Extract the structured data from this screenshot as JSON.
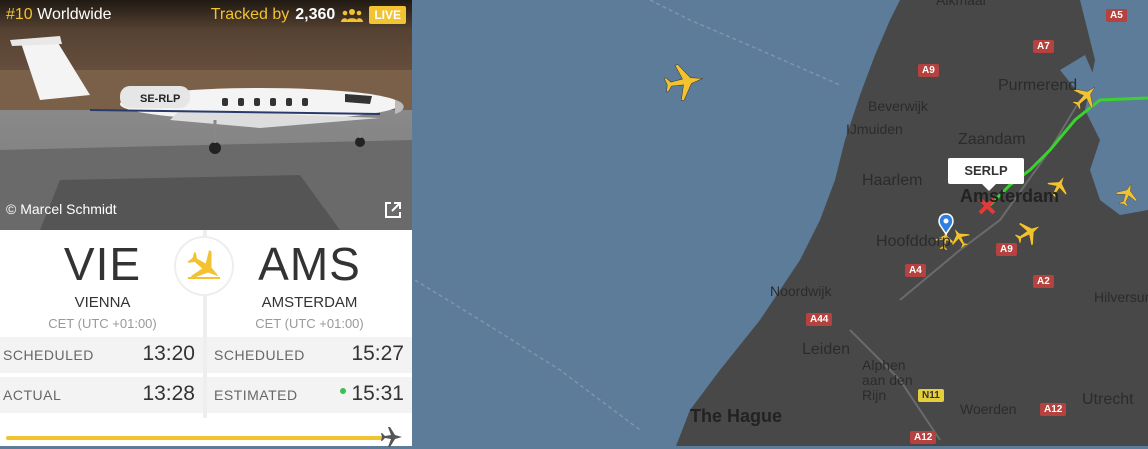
{
  "header": {
    "rank_prefix": "#10",
    "rank_suffix": "Worldwide",
    "tracked_label": "Tracked by",
    "tracked_count": "2,360",
    "live": "LIVE"
  },
  "photo": {
    "credit": "© Marcel Schmidt",
    "registration": "SE-RLP"
  },
  "origin": {
    "code": "VIE",
    "city": "VIENNA",
    "tz": "CET (UTC +01:00)"
  },
  "destination": {
    "code": "AMS",
    "city": "AMSTERDAM",
    "tz": "CET (UTC +01:00)"
  },
  "times": {
    "dep_scheduled_label": "SCHEDULED",
    "dep_scheduled": "13:20",
    "dep_actual_label": "ACTUAL",
    "dep_actual": "13:28",
    "arr_scheduled_label": "SCHEDULED",
    "arr_scheduled": "15:27",
    "arr_estimated_label": "ESTIMATED",
    "arr_estimated": "15:31"
  },
  "progress": 0.96,
  "map": {
    "callsign": "SERLP",
    "places": [
      "Alkmaar",
      "Beverwijk",
      "IJmuiden",
      "Zaandam",
      "Purmerend",
      "Haarlem",
      "Amsterdam",
      "Hoofddorp",
      "Noordwijk",
      "Leiden",
      "Alphen aan den Rijn",
      "The Hague",
      "Woerden",
      "Utrecht",
      "Hilversum"
    ],
    "roads": [
      "A7",
      "A9",
      "A4",
      "A9",
      "A2",
      "A44",
      "N11",
      "A12",
      "A12",
      "A5"
    ]
  },
  "colors": {
    "accent": "#f2c230",
    "sea": "#5d7c99",
    "land": "#4a4a4a",
    "track": "#39d22f",
    "estimated_dot": "#3bbf55"
  }
}
